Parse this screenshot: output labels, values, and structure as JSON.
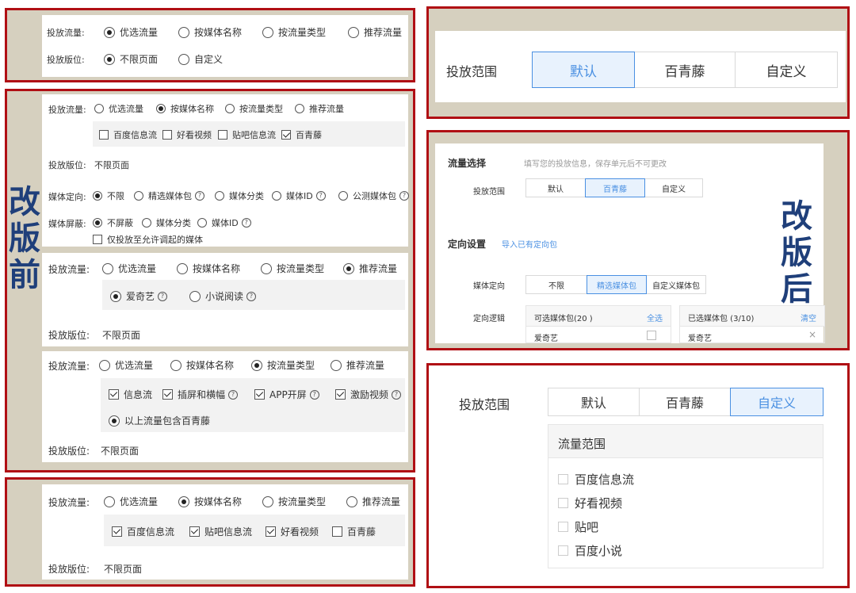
{
  "colors": {
    "frame": "#b00f14",
    "frame_fill": "#d6d0bf",
    "accent": "#4a90e2",
    "title_blue": "#1f3f7a"
  },
  "before_label": [
    "改",
    "版",
    "前"
  ],
  "after_label": [
    "改",
    "版",
    "后"
  ],
  "panel_a": {
    "traffic_label": "投放流量:",
    "traffic_options": [
      "优选流量",
      "按媒体名称",
      "按流量类型",
      "推荐流量"
    ],
    "traffic_selected": 0,
    "slot_label": "投放版位:",
    "slot_options": [
      "不限页面",
      "自定义"
    ],
    "slot_selected": 0
  },
  "panel_b": {
    "traffic_label": "投放流量:",
    "traffic_options": [
      "优选流量",
      "按媒体名称",
      "按流量类型",
      "推荐流量"
    ],
    "media_checks": [
      "百度信息流",
      "好看视频",
      "贴吧信息流",
      "百青藤"
    ],
    "slot_label": "投放版位:",
    "slot_value": "不限页面",
    "targeting_label": "媒体定向:",
    "targeting_options": [
      "不限",
      "精选媒体包",
      "媒体分类",
      "媒体ID",
      "公测媒体包"
    ],
    "block_label": "媒体屏蔽:",
    "block_options": [
      "不屏蔽",
      "媒体分类",
      "媒体ID"
    ],
    "only_allowed": "仅投放至允许调起的媒体"
  },
  "panel_c": {
    "traffic_label": "投放流量:",
    "traffic_options": [
      "优选流量",
      "按媒体名称",
      "按流量类型",
      "推荐流量"
    ],
    "sub_options": [
      "爱奇艺",
      "小说阅读"
    ],
    "slot_label": "投放版位:",
    "slot_value": "不限页面"
  },
  "panel_d": {
    "traffic_label": "投放流量:",
    "traffic_options": [
      "优选流量",
      "按媒体名称",
      "按流量类型",
      "推荐流量"
    ],
    "type_checks": [
      "信息流",
      "插屏和横幅",
      "APP开屏",
      "激励视频"
    ],
    "include_bqt": "以上流量包含百青藤",
    "slot_label": "投放版位:",
    "slot_value": "不限页面"
  },
  "panel_e": {
    "traffic_label": "投放流量:",
    "traffic_options": [
      "优选流量",
      "按媒体名称",
      "按流量类型",
      "推荐流量"
    ],
    "media_checks": [
      "百度信息流",
      "贴吧信息流",
      "好看视频",
      "百青藤"
    ],
    "slot_label": "投放版位:",
    "slot_value": "不限页面"
  },
  "panel_f": {
    "scope_label": "投放范围",
    "scope_options": [
      "默认",
      "百青藤",
      "自定义"
    ]
  },
  "panel_g": {
    "traffic_select_title": "流量选择",
    "traffic_select_hint": "填写您的投放信息，保存单元后不可更改",
    "scope_label": "投放范围",
    "scope_options": [
      "默认",
      "百青藤",
      "自定义"
    ],
    "targeting_title": "定向设置",
    "import_link": "导入已有定向包",
    "media_targeting_label": "媒体定向",
    "media_targeting_options": [
      "不限",
      "精选媒体包",
      "自定义媒体包"
    ],
    "logic_label": "定向逻辑",
    "available_title": "可选媒体包(20 )",
    "select_all": "全选",
    "available_item": "爱奇艺",
    "selected_title": "已选媒体包 (3/10)",
    "clear": "清空",
    "selected_item": "爱奇艺"
  },
  "panel_h": {
    "scope_label": "投放范围",
    "scope_options": [
      "默认",
      "百青藤",
      "自定义"
    ],
    "range_title": "流量范围",
    "range_items": [
      "百度信息流",
      "好看视频",
      "贴吧",
      "百度小说"
    ]
  }
}
